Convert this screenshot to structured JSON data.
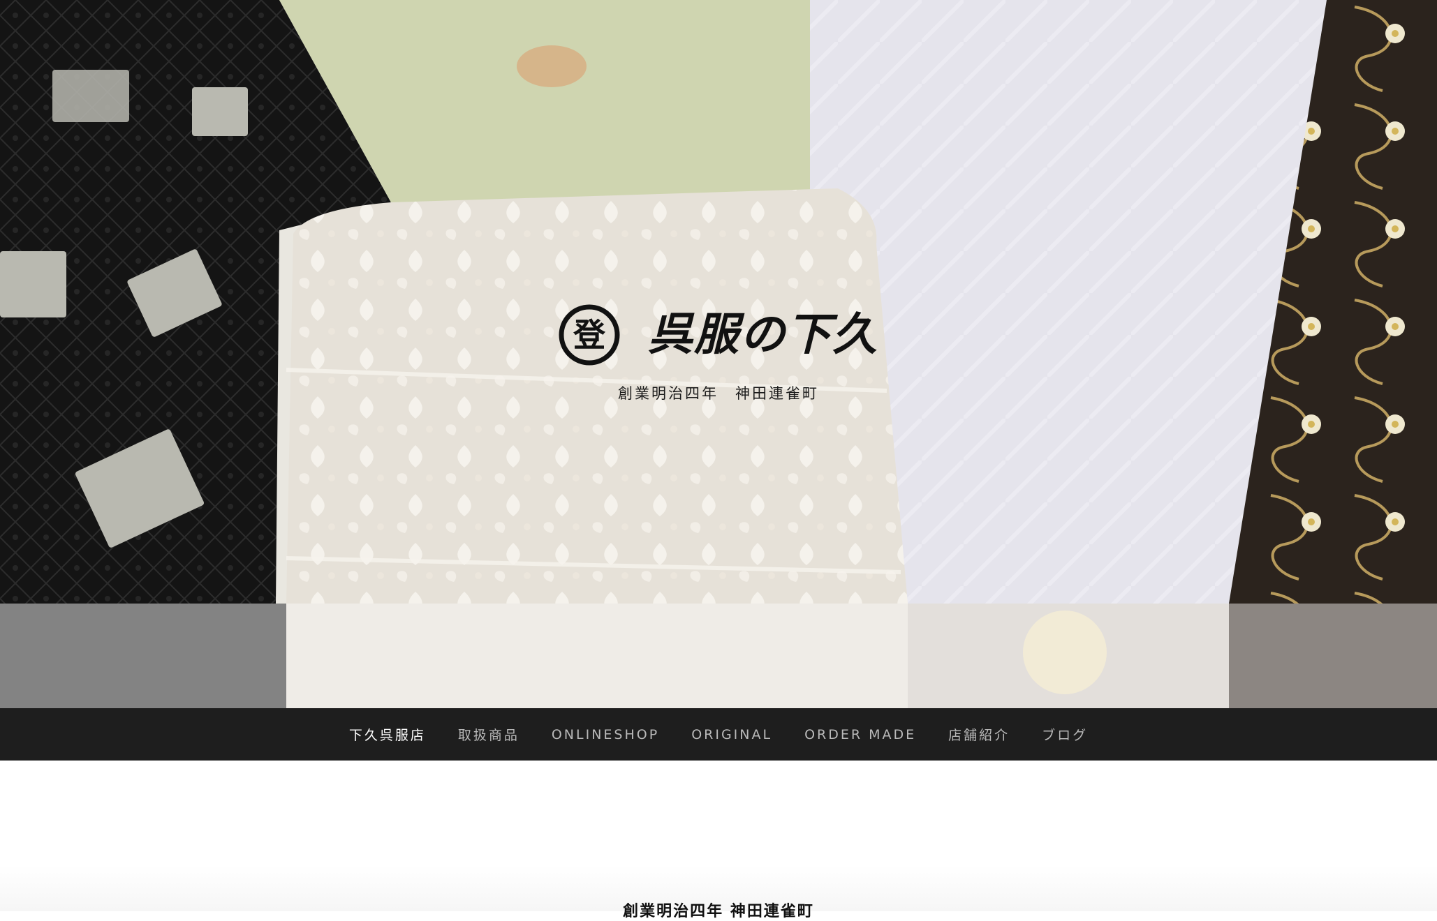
{
  "hero": {
    "brand_name": "呉服の下久",
    "crest_char": "登",
    "tagline": "創業明治四年　神田連雀町"
  },
  "nav": {
    "items": [
      {
        "label": "下久呉服店"
      },
      {
        "label": "取扱商品"
      },
      {
        "label": "ONLINESHOP"
      },
      {
        "label": "ORIGINAL"
      },
      {
        "label": "ORDER MADE"
      },
      {
        "label": "店舗紹介"
      },
      {
        "label": "ブログ"
      }
    ]
  },
  "main": {
    "heading": "創業明治四年 神田連雀町"
  },
  "colors": {
    "nav_bg": "#1e1e1e",
    "nav_text": "#b9b9b9",
    "nav_active": "#ffffff"
  }
}
